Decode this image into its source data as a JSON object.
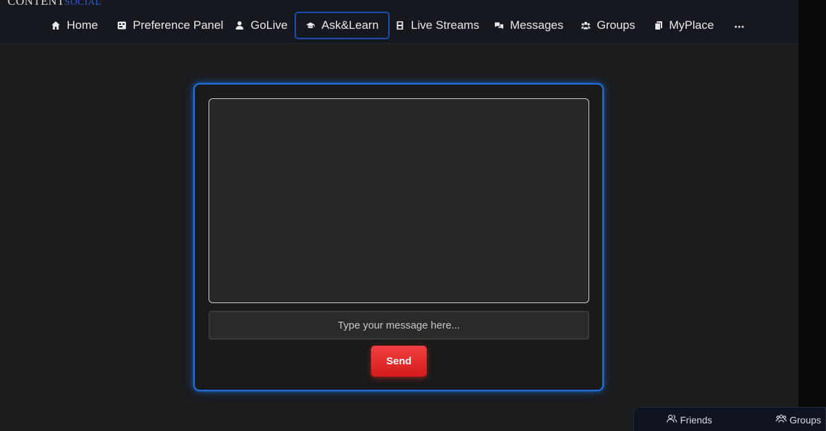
{
  "brand": {
    "part1": "CONTENT",
    "part2": "SOCIAL"
  },
  "nav": {
    "items": [
      {
        "label": "Home",
        "icon": "home-icon"
      },
      {
        "label": "Preference Panel",
        "icon": "preferences-icon"
      },
      {
        "label": "GoLive",
        "icon": "user-icon"
      },
      {
        "label": "Ask&Learn",
        "icon": "graduation-cap-icon",
        "active": true
      },
      {
        "label": "Live Streams",
        "icon": "film-icon"
      },
      {
        "label": "Messages",
        "icon": "comments-icon"
      },
      {
        "label": "Groups",
        "icon": "users-icon"
      },
      {
        "label": "MyPlace",
        "icon": "copy-icon"
      }
    ],
    "more_icon": "ellipsis-icon"
  },
  "chat": {
    "input_placeholder": "Type your message here...",
    "input_value": "",
    "send_label": "Send"
  },
  "dock": {
    "friends_label": "Friends",
    "groups_label": "Groups"
  },
  "colors": {
    "accent_blue": "#1f6fe0",
    "send_red": "#e02626",
    "background": "#1b1c1e"
  }
}
